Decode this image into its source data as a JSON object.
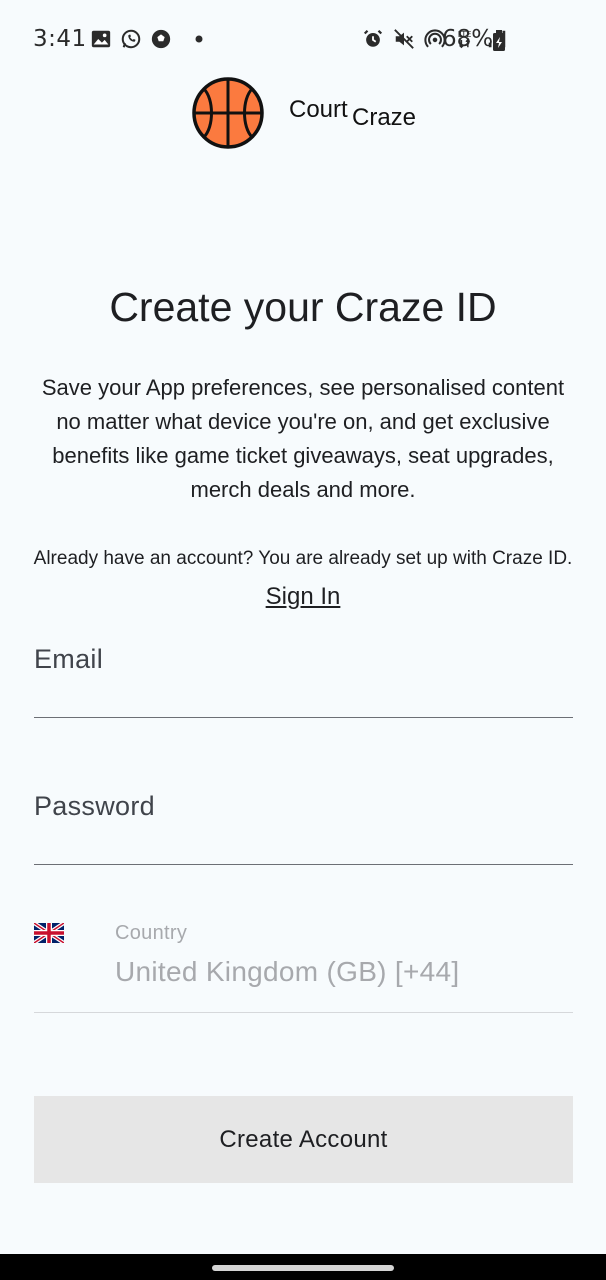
{
  "status_bar": {
    "time": "3:41",
    "battery": "68%",
    "left_icons": [
      "image-icon",
      "whatsapp-icon",
      "soccer-ball-icon",
      "dot-icon"
    ],
    "right_icons": [
      "alarm-icon",
      "mute-icon",
      "hotspot-icon",
      "lte-icon",
      "signal-icon",
      "battery-icon"
    ]
  },
  "brand": {
    "part1": "Court",
    "part2": "Craze",
    "logo_icon": "basketball-icon",
    "logo_color": "#fb7a3f"
  },
  "page": {
    "title": "Create your Craze ID",
    "description": "Save your App preferences, see personalised content no matter what device you're on, and get exclusive benefits like game ticket giveaways, seat upgrades, merch deals and more.",
    "signin_prompt": "Already have an account? You are already set up with Craze ID.",
    "signin_link": "Sign In"
  },
  "form": {
    "email_label": "Email",
    "password_label": "Password",
    "country_label": "Country",
    "country_value": "United Kingdom (GB) [+44]",
    "country_flag": "uk-flag-icon",
    "submit_label": "Create Account"
  },
  "colors": {
    "background": "#f7fbfd",
    "button_bg": "#e6e6e6",
    "placeholder": "#a7a9ad"
  }
}
